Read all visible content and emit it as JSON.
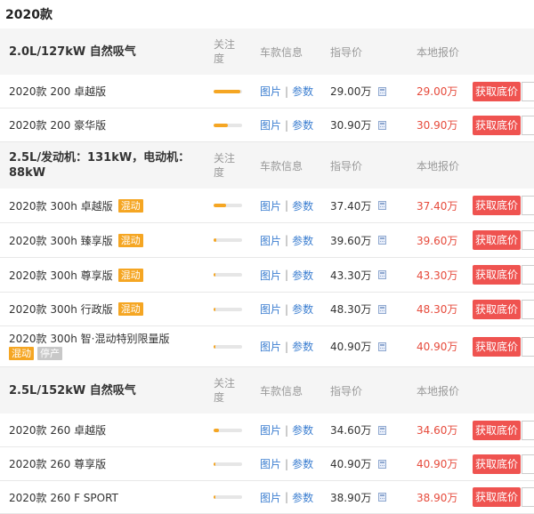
{
  "page_title": "2020款",
  "groups": [
    {
      "name": "2.0L/127kW 自然吸气",
      "col_attention": "关注度",
      "col_info": "车款信息",
      "col_guide": "指导价",
      "col_local": "本地报价",
      "models": [
        {
          "name": "2020款 200 卓越版",
          "badges": [],
          "attention": 0.95,
          "link_pic": "图片",
          "sep": "|",
          "link_param": "参数",
          "guide_price": "29.00万",
          "local_price": "29.00万",
          "button": "获取底价"
        },
        {
          "name": "2020款 200 豪华版",
          "badges": [],
          "attention": 0.5,
          "link_pic": "图片",
          "sep": "|",
          "link_param": "参数",
          "guide_price": "30.90万",
          "local_price": "30.90万",
          "button": "获取底价"
        }
      ]
    },
    {
      "name": "2.5L/发动机：131kW，电动机：88kW",
      "col_attention": "关注度",
      "col_info": "车款信息",
      "col_guide": "指导价",
      "col_local": "本地报价",
      "models": [
        {
          "name": "2020款 300h 卓越版",
          "badges": [
            "混动"
          ],
          "attention": 0.45,
          "link_pic": "图片",
          "sep": "|",
          "link_param": "参数",
          "guide_price": "37.40万",
          "local_price": "37.40万",
          "button": "获取底价"
        },
        {
          "name": "2020款 300h 臻享版",
          "badges": [
            "混动"
          ],
          "attention": 0.08,
          "link_pic": "图片",
          "sep": "|",
          "link_param": "参数",
          "guide_price": "39.60万",
          "local_price": "39.60万",
          "button": "获取底价"
        },
        {
          "name": "2020款 300h 尊享版",
          "badges": [
            "混动"
          ],
          "attention": 0.06,
          "link_pic": "图片",
          "sep": "|",
          "link_param": "参数",
          "guide_price": "43.30万",
          "local_price": "43.30万",
          "button": "获取底价"
        },
        {
          "name": "2020款 300h 行政版",
          "badges": [
            "混动"
          ],
          "attention": 0.06,
          "link_pic": "图片",
          "sep": "|",
          "link_param": "参数",
          "guide_price": "48.30万",
          "local_price": "48.30万",
          "button": "获取底价"
        },
        {
          "name": "2020款 300h 智·混动特别限量版",
          "badges": [
            "混动",
            "停产"
          ],
          "attention": 0.05,
          "link_pic": "图片",
          "sep": "|",
          "link_param": "参数",
          "guide_price": "40.90万",
          "local_price": "40.90万",
          "button": "获取底价"
        }
      ]
    },
    {
      "name": "2.5L/152kW 自然吸气",
      "col_attention": "关注度",
      "col_info": "车款信息",
      "col_guide": "指导价",
      "col_local": "本地报价",
      "models": [
        {
          "name": "2020款 260 卓越版",
          "badges": [],
          "attention": 0.2,
          "link_pic": "图片",
          "sep": "|",
          "link_param": "参数",
          "guide_price": "34.60万",
          "local_price": "34.60万",
          "button": "获取底价"
        },
        {
          "name": "2020款 260 尊享版",
          "badges": [],
          "attention": 0.06,
          "link_pic": "图片",
          "sep": "|",
          "link_param": "参数",
          "guide_price": "40.90万",
          "local_price": "40.90万",
          "button": "获取底价"
        },
        {
          "name": "2020款 260 F SPORT",
          "badges": [],
          "attention": 0.06,
          "link_pic": "图片",
          "sep": "|",
          "link_param": "参数",
          "guide_price": "38.90万",
          "local_price": "38.90万",
          "button": "获取底价"
        }
      ]
    }
  ]
}
